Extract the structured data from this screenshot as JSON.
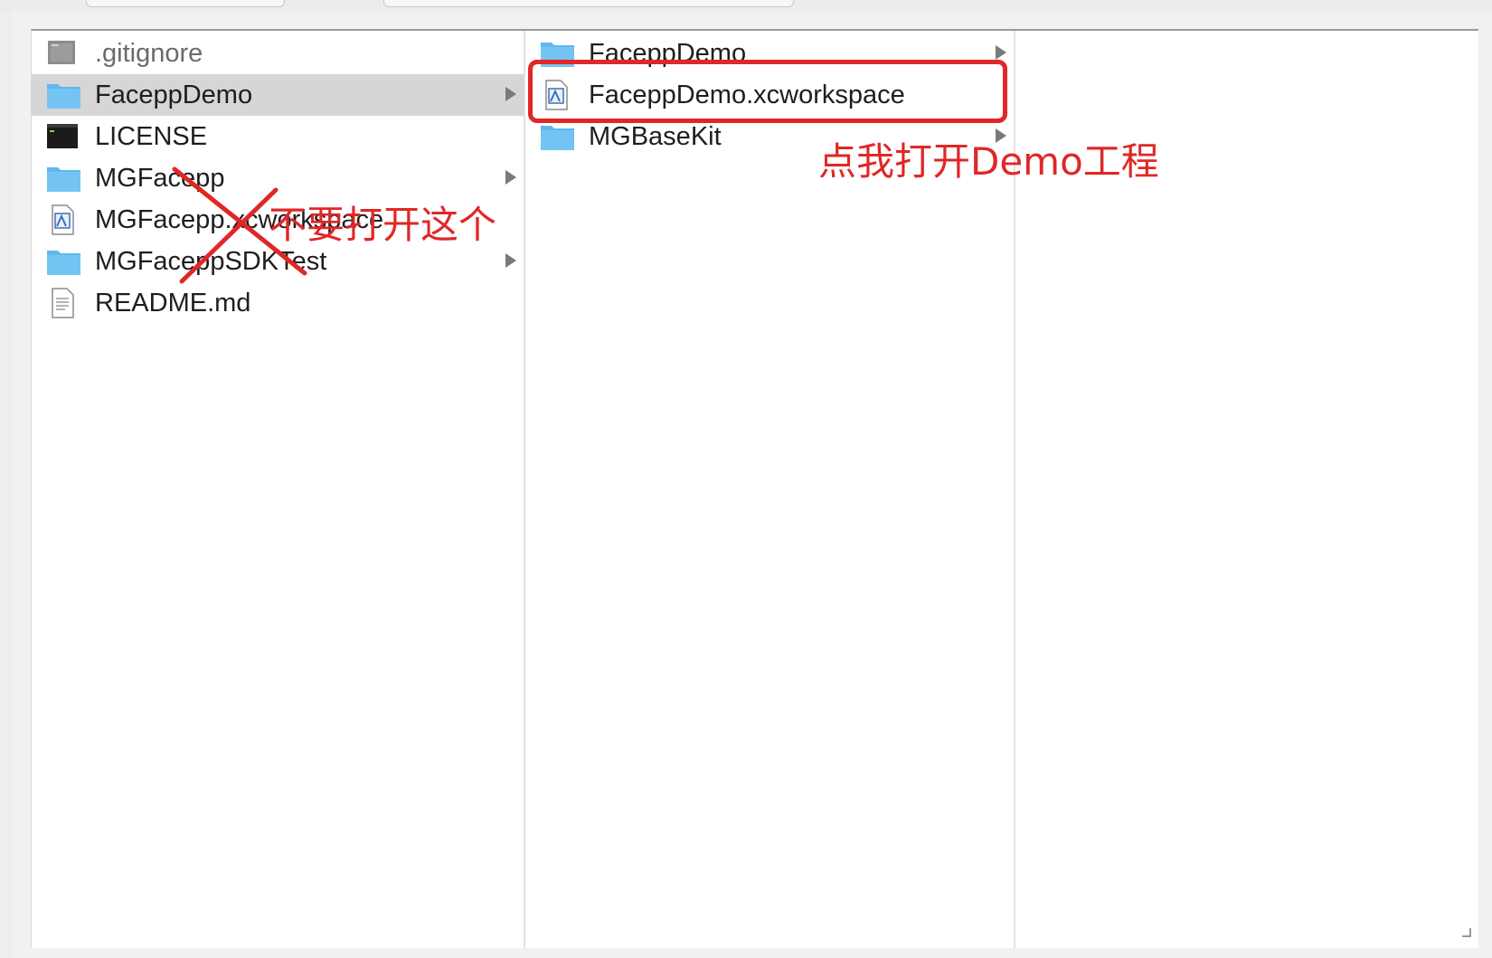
{
  "columns": [
    {
      "items": [
        {
          "name": ".gitignore",
          "icon": "document-generic-icon",
          "has_children": false,
          "selected": false,
          "dim": true
        },
        {
          "name": "FaceppDemo",
          "icon": "folder-icon",
          "has_children": true,
          "selected": true
        },
        {
          "name": "LICENSE",
          "icon": "terminal-exec-icon",
          "has_children": false,
          "selected": false
        },
        {
          "name": "MGFacepp",
          "icon": "folder-icon",
          "has_children": true,
          "selected": false
        },
        {
          "name": "MGFacepp.xcworkspace",
          "icon": "xcode-workspace-icon",
          "has_children": false,
          "selected": false
        },
        {
          "name": "MGFaceppSDKTest",
          "icon": "folder-icon",
          "has_children": true,
          "selected": false
        },
        {
          "name": "README.md",
          "icon": "text-document-icon",
          "has_children": false,
          "selected": false
        }
      ]
    },
    {
      "items": [
        {
          "name": "FaceppDemo",
          "icon": "folder-icon",
          "has_children": true,
          "selected": false
        },
        {
          "name": "FaceppDemo.xcworkspace",
          "icon": "xcode-workspace-icon",
          "has_children": false,
          "selected": false
        },
        {
          "name": "MGBaseKit",
          "icon": "folder-icon",
          "has_children": true,
          "selected": false
        }
      ]
    },
    {
      "items": []
    }
  ],
  "annotations": {
    "open_this": "点我打开Demo工程",
    "do_not_open": "不要打开这个",
    "color": "#e02727"
  },
  "colors": {
    "folder": "#5fb7ee",
    "selection": "#d6d6d6",
    "annotation": "#e02727"
  }
}
